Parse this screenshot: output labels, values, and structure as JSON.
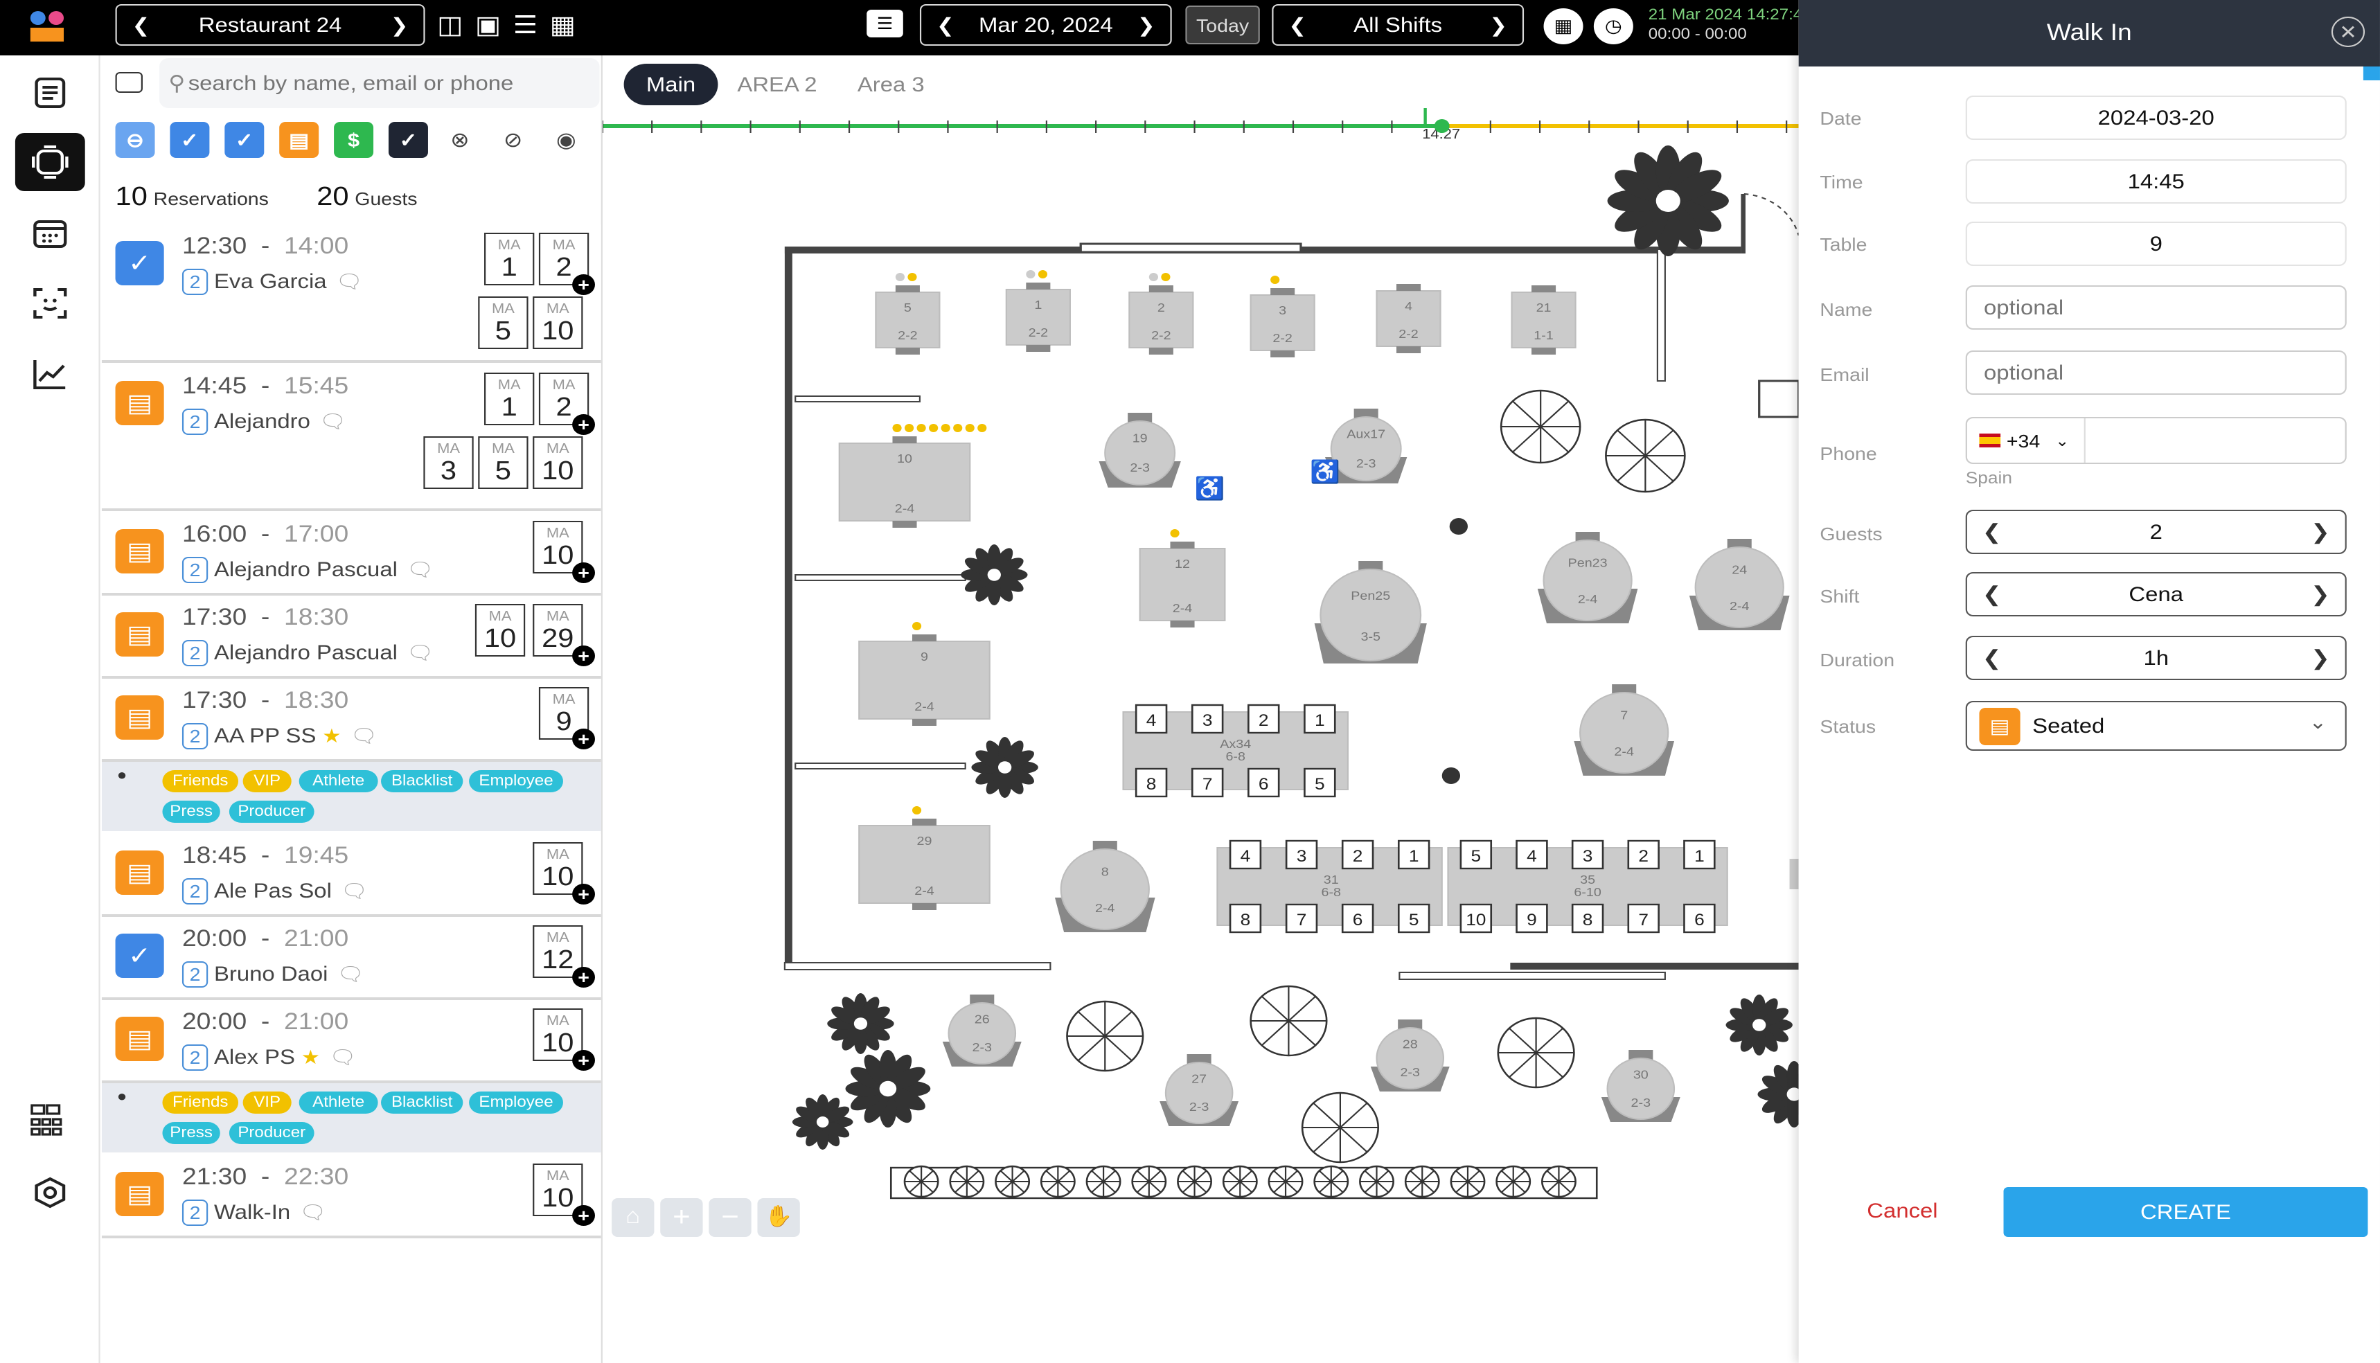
{
  "topbar": {
    "restaurant": "Restaurant 24",
    "date": "Mar 20, 2024",
    "today": "Today",
    "shifts": "All Shifts",
    "datetime": "21 Mar 2024 14:27:4",
    "timerange": "00:00 - 00:00"
  },
  "sidebar": {
    "items": [
      "list-icon",
      "floor-icon",
      "calendar-icon",
      "face-icon",
      "chart-icon",
      "grid-icon",
      "settings-icon"
    ]
  },
  "list": {
    "search_placeholder": "search by name, email or phone",
    "reservations_count": "10",
    "reservations_label": "Reservations",
    "guests_count": "20",
    "guests_label": "Guests",
    "ma": "MA",
    "tags": [
      "Friends",
      "VIP",
      "Athlete",
      "Blacklist",
      "Employee",
      "Press",
      "Producer"
    ],
    "tag_colors": {
      "Friends": "#f2c100",
      "VIP": "#f2c100",
      "Athlete": "#2ec0d8",
      "Blacklist": "#2ec0d8",
      "Employee": "#2ec0d8",
      "Press": "#2ec0d8",
      "Producer": "#2ec0d8"
    },
    "items": [
      {
        "start": "12:30",
        "end": "14:00",
        "guests": "2",
        "name": "Eva Garcia",
        "status": "confirmed",
        "tables": [
          "1",
          "2",
          "5",
          "10"
        ]
      },
      {
        "start": "14:45",
        "end": "15:45",
        "guests": "2",
        "name": "Alejandro",
        "status": "seated",
        "tables": [
          "1",
          "2",
          "3",
          "5",
          "10"
        ]
      },
      {
        "start": "16:00",
        "end": "17:00",
        "guests": "2",
        "name": "Alejandro Pascual",
        "status": "seated",
        "tables": [
          "10"
        ]
      },
      {
        "start": "17:30",
        "end": "18:30",
        "guests": "2",
        "name": "Alejandro Pascual",
        "status": "seated",
        "tables": [
          "10",
          "29"
        ]
      },
      {
        "start": "17:30",
        "end": "18:30",
        "guests": "2",
        "name": "AA PP SS",
        "status": "seated",
        "tables": [
          "9"
        ]
      },
      {
        "start": "18:45",
        "end": "19:45",
        "guests": "2",
        "name": "Ale Pas Sol",
        "status": "seated",
        "tables": [
          "10"
        ]
      },
      {
        "start": "20:00",
        "end": "21:00",
        "guests": "2",
        "name": "Bruno Daoi",
        "status": "confirmed",
        "tables": [
          "12"
        ]
      },
      {
        "start": "20:00",
        "end": "21:00",
        "guests": "2",
        "name": "Alex PS",
        "status": "seated",
        "tables": [
          "10"
        ]
      },
      {
        "start": "21:30",
        "end": "22:30",
        "guests": "2",
        "name": "Walk-In",
        "status": "seated",
        "tables": [
          "10"
        ]
      }
    ]
  },
  "floor": {
    "tabs": [
      "Main",
      "AREA 2",
      "Area 3"
    ],
    "timeline_now": "14:27",
    "tables": [
      {
        "id": "5",
        "cap": "2-2"
      },
      {
        "id": "1",
        "cap": "2-2"
      },
      {
        "id": "2",
        "cap": "2-2"
      },
      {
        "id": "3",
        "cap": "2-2"
      },
      {
        "id": "4",
        "cap": "2-2"
      },
      {
        "id": "21",
        "cap": "1-1"
      },
      {
        "id": "10",
        "cap": "2-4"
      },
      {
        "id": "19",
        "cap": "2-3"
      },
      {
        "id": "Aux17",
        "cap": "2-3"
      },
      {
        "id": "12",
        "cap": "2-4"
      },
      {
        "id": "Pen25",
        "cap": "3-5"
      },
      {
        "id": "Pen23",
        "cap": "2-4"
      },
      {
        "id": "24",
        "cap": "2-4"
      },
      {
        "id": "9",
        "cap": "2-4"
      },
      {
        "id": "7",
        "cap": "2-4"
      },
      {
        "id": "29",
        "cap": "2-4"
      },
      {
        "id": "8",
        "cap": "2-4"
      },
      {
        "id": "26",
        "cap": "2-3"
      },
      {
        "id": "27",
        "cap": "2-3"
      },
      {
        "id": "28",
        "cap": "2-3"
      },
      {
        "id": "30",
        "cap": "2-3"
      }
    ],
    "combo1": {
      "label": "Ax34",
      "cap": "6-8",
      "top": [
        "4",
        "3",
        "2",
        "1"
      ],
      "bottom": [
        "8",
        "7",
        "6",
        "5"
      ]
    },
    "combo2": {
      "label": "31",
      "cap": "6-8",
      "top": [
        "4",
        "3",
        "2",
        "1"
      ],
      "bottom": [
        "8",
        "7",
        "6",
        "5"
      ]
    },
    "combo3": {
      "label": "35",
      "cap": "6-10",
      "top": [
        "5",
        "4",
        "3",
        "2",
        "1"
      ],
      "bottom": [
        "10",
        "9",
        "8",
        "7",
        "6"
      ]
    }
  },
  "panel": {
    "title": "Walk In",
    "date_label": "Date",
    "date": "2024-03-20",
    "time_label": "Time",
    "time": "14:45",
    "table_label": "Table",
    "table": "9",
    "name_label": "Name",
    "name_placeholder": "optional",
    "email_label": "Email",
    "email_placeholder": "optional",
    "phone_label": "Phone",
    "phone_code": "+34",
    "phone_country": "Spain",
    "guests_label": "Guests",
    "guests": "2",
    "shift_label": "Shift",
    "shift": "Cena",
    "duration_label": "Duration",
    "duration": "1h",
    "status_label": "Status",
    "status": "Seated",
    "cancel": "Cancel",
    "create": "CREATE"
  },
  "colors": {
    "seated": "#f7931e",
    "confirmed": "#3f87e5",
    "green": "#2eb84f",
    "yellow": "#f2c100",
    "accent": "#2aa4ea"
  }
}
